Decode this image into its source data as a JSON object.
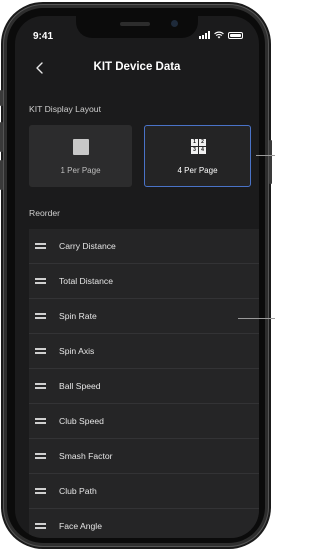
{
  "status_bar": {
    "time": "9:41"
  },
  "nav": {
    "title": "KIT Device Data",
    "back_icon": "chevron-left-icon"
  },
  "display_layout": {
    "heading": "KIT Display Layout",
    "options": [
      {
        "label": "1 Per Page",
        "selected": false,
        "icon": "single-square-icon"
      },
      {
        "label": "4 Per Page",
        "selected": true,
        "icon": "four-grid-icon",
        "grid_numbers": [
          "1",
          "2",
          "3",
          "4"
        ]
      }
    ]
  },
  "reorder": {
    "heading": "Reorder",
    "handle_icon": "drag-handle-icon",
    "items": [
      "Carry Distance",
      "Total Distance",
      "Spin Rate",
      "Spin Axis",
      "Ball Speed",
      "Club Speed",
      "Smash Factor",
      "Club Path",
      "Face Angle"
    ]
  },
  "colors": {
    "background": "#1b1b1c",
    "card": "#2c2c2d",
    "selected_border": "#4a73c8",
    "text": "#e6e6e6"
  }
}
